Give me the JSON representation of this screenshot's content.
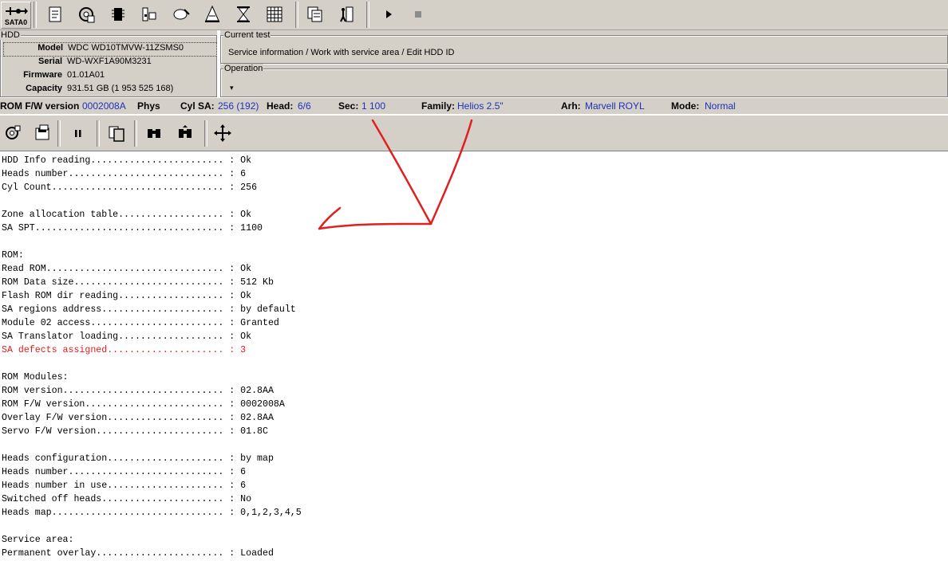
{
  "toolbar": {
    "port_label": "SATA0",
    "icons": [
      "port-icon",
      "scroll-icon",
      "gear-disk-icon",
      "chip-icon",
      "tree-icon",
      "disk-edit-icon",
      "flask-icon",
      "hourglass-icon",
      "grid-icon",
      "copy-icon",
      "exit-icon",
      "play-icon",
      "stop-icon"
    ]
  },
  "hdd": {
    "title": "HDD",
    "model_label": "Model",
    "model": "WDC WD10TMVW-11ZSMS0",
    "serial_label": "Serial",
    "serial": "WD-WXF1A90M3231",
    "firmware_label": "Firmware",
    "firmware": "01.01A01",
    "capacity_label": "Capacity",
    "capacity": "931.51 GB (1 953 525 168)"
  },
  "current_test": {
    "title": "Current test",
    "value": "Service information / Work with service area / Edit HDD ID"
  },
  "operation": {
    "title": "Operation",
    "value": "▾"
  },
  "infobar": {
    "rom_label": "ROM F/W version",
    "rom_value": "0002008A",
    "phys_label": "Phys",
    "cyl_label": "Cyl SA:",
    "cyl_value": "256 (192)",
    "head_label": "Head:",
    "head_value": "6/6",
    "sec_label": "Sec:",
    "sec_value": "1 100",
    "family_label": "Family:",
    "family_value": "Helios 2.5\"",
    "arh_label": "Arh:",
    "arh_value": "Marvell ROYL",
    "mode_label": "Mode:",
    "mode_value": "Normal"
  },
  "colors": {
    "panel": "#d4d0c8",
    "link_value": "#1f2fbf",
    "warning": "#e02020",
    "annotation": "#e02020"
  },
  "log": [
    {
      "text": "HDD Info reading........................ : Ok",
      "red": false
    },
    {
      "text": "Heads number............................ : 6",
      "red": false
    },
    {
      "text": "Cyl Count............................... : 256",
      "red": false
    },
    {
      "text": "",
      "red": false
    },
    {
      "text": "Zone allocation table................... : Ok",
      "red": false
    },
    {
      "text": "SA SPT.................................. : 1100",
      "red": false
    },
    {
      "text": "",
      "red": false
    },
    {
      "text": "ROM:",
      "red": false
    },
    {
      "text": "Read ROM................................ : Ok",
      "red": false
    },
    {
      "text": "ROM Data size........................... : 512 Kb",
      "red": false
    },
    {
      "text": "Flash ROM dir reading................... : Ok",
      "red": false
    },
    {
      "text": "SA regions address...................... : by default",
      "red": false
    },
    {
      "text": "Module 02 access........................ : Granted",
      "red": false
    },
    {
      "text": "SA Translator loading................... : Ok",
      "red": false
    },
    {
      "text": "SA defects assigned..................... : 3",
      "red": true
    },
    {
      "text": "",
      "red": false
    },
    {
      "text": "ROM Modules:",
      "red": false
    },
    {
      "text": "ROM version............................. : 02.8AA",
      "red": false
    },
    {
      "text": "ROM F/W version......................... : 0002008A",
      "red": false
    },
    {
      "text": "Overlay F/W version..................... : 02.8AA",
      "red": false
    },
    {
      "text": "Servo F/W version....................... : 01.8C",
      "red": false
    },
    {
      "text": "",
      "red": false
    },
    {
      "text": "Heads configuration..................... : by map",
      "red": false
    },
    {
      "text": "Heads number............................ : 6",
      "red": false
    },
    {
      "text": "Heads number in use..................... : 6",
      "red": false
    },
    {
      "text": "Switched off heads...................... : No",
      "red": false
    },
    {
      "text": "Heads map............................... : 0,1,2,3,4,5",
      "red": false
    },
    {
      "text": "",
      "red": false
    },
    {
      "text": "Service area:",
      "red": false
    },
    {
      "text": "Permanent overlay....................... : Loaded",
      "red": false
    }
  ]
}
